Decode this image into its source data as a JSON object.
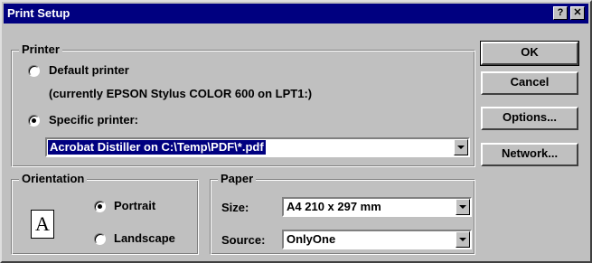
{
  "window": {
    "title": "Print Setup",
    "help_button": "?",
    "close_button": "✕"
  },
  "printer_group": {
    "legend": "Printer",
    "default_label": "Default printer",
    "default_note": "(currently EPSON Stylus COLOR 600 on LPT1:)",
    "specific_label": "Specific printer:",
    "selected": "specific",
    "specific_value": "Acrobat Distiller on C:\\Temp\\PDF\\*.pdf"
  },
  "orientation_group": {
    "legend": "Orientation",
    "page_glyph": "A",
    "portrait_label": "Portrait",
    "landscape_label": "Landscape",
    "selected": "portrait"
  },
  "paper_group": {
    "legend": "Paper",
    "size_label": "Size:",
    "size_value": "A4 210 x 297 mm",
    "source_label": "Source:",
    "source_value": "OnlyOne"
  },
  "buttons": {
    "ok": "OK",
    "cancel": "Cancel",
    "options": "Options...",
    "network": "Network..."
  },
  "colors": {
    "titlebar": "#000080",
    "face": "#c0c0c0",
    "selection": "#000080"
  }
}
